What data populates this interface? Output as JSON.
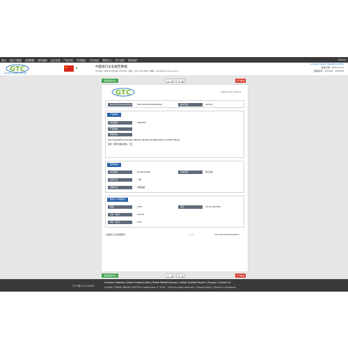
{
  "topnav": {
    "items": [
      "首页",
      "进出口数据",
      "全球数据",
      "海关编码",
      "企业名录",
      "产品分析",
      "市场报告",
      "行业动态",
      "帮助中心",
      "关于我们",
      "联系我们"
    ],
    "right": "Stocks"
  },
  "header": {
    "logo_text": "GTC",
    "logo_sub": "GLOBAL TRADE ONLINE",
    "title": "中国进口企业报告数据",
    "contact": "GLOBAL TRADE ONLINE LIMITED | 电话：400-710-3008 | 电邮：sales@gtcchina.com.cn",
    "right_line1": "GLOBAL TRADE ONLINE LIMITED",
    "right_line2": "报告日期：2018-10-27",
    "right_line3": "数据来源：10/2007 - 10/2018"
  },
  "toolbar": {
    "back_label": "返回数据列表",
    "prev_label": "上一条",
    "next_label": "下一条",
    "print_label": "打印报告"
  },
  "card": {
    "logo_text": "GTC",
    "date": "2018-10-30 14:22:51",
    "id_row": {
      "label1": "Global Trade Identifier",
      "value1": "22012017D0000049912C",
      "label2": "报关日期",
      "value2": "201701"
    },
    "product": {
      "title": "产品信息",
      "hs_label": "海关编码",
      "hs_value": "3006000",
      "desc_label": "产品描述",
      "unit_label": "申报单位",
      "desc_line1": "PHOTOGRAPHIC PICTURE SIMILAR TRADES IN EMPOWER OF SHEET METAL",
      "desc_line2": "用途：摄影及类似用途，无上"
    },
    "trade": {
      "title": "贸易信息",
      "r1_label": "进口地区",
      "r1_value": "IN 340-94494",
      "r1_label2": "关区名称",
      "r1_value2": "南京海关",
      "r2_label": "贸易方式",
      "r2_value": "一般",
      "r3_label": "运输方式",
      "r3_value": "水路运输"
    },
    "quantity": {
      "title": "数量 & 价格信息",
      "r1_label": "数量",
      "r1_value": "2700",
      "r1_label2": "单位",
      "r1_value2": "KG 60-0007649",
      "r2_label": "总价（美元）",
      "r2_value": "234.69",
      "r3_label": "单价（美元）",
      "r3_value": "0.62"
    },
    "footer_left": "中国进口企业数据报告",
    "footer_mid": "1 / 1",
    "footer_right": "22012017D0000049912T"
  },
  "footer": {
    "icp": "沪ICP备14015888号",
    "links": "Company Website  |  Global Customs Data  |  Global Market Analysis  |  Global Qualified Buyers  |  Enquiry  |  Contact Us",
    "copyright": "GLOBAL TRADE ONLINE LIMITED is authorized. © 2016 - 2018 All rights reserved.  |  Privacy Policy  |  Terms & Conditions"
  },
  "colors": {
    "accent": "#2c63aa",
    "green": "#3fa34d",
    "red": "#d9342b",
    "nav_bg": "#3b3b3b"
  }
}
